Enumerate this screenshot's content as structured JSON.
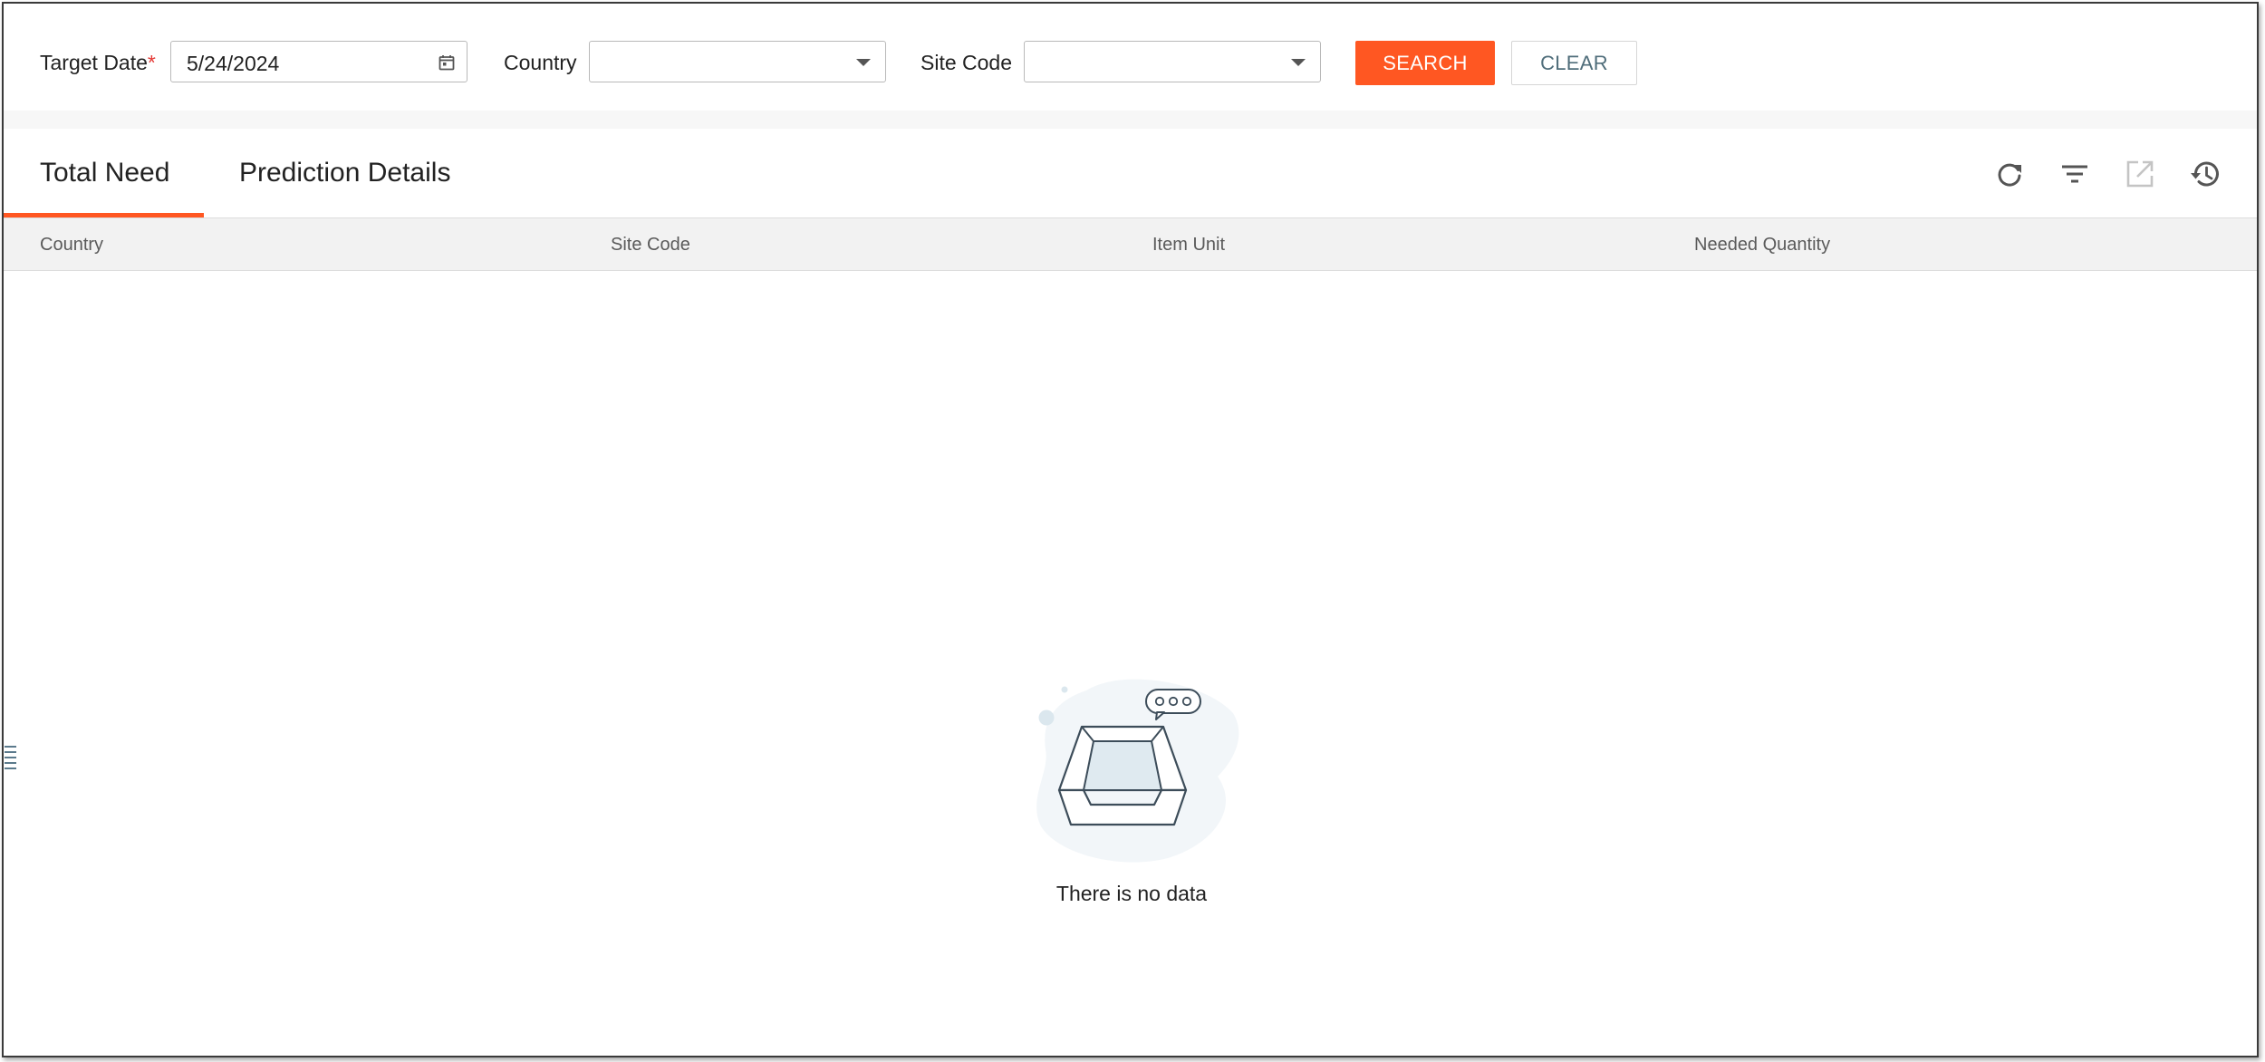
{
  "filters": {
    "target_date_label": "Target Date",
    "required_mark": "*",
    "target_date_value": "5/24/2024",
    "country_label": "Country",
    "country_value": "",
    "site_code_label": "Site Code",
    "site_code_value": "",
    "search_label": "SEARCH",
    "clear_label": "CLEAR"
  },
  "tabs": [
    {
      "label": "Total Need",
      "active": true
    },
    {
      "label": "Prediction Details",
      "active": false
    }
  ],
  "toolbar": {
    "icons": [
      "refresh-icon",
      "filter-icon",
      "export-icon",
      "history-icon"
    ]
  },
  "table": {
    "columns": [
      "Country",
      "Site Code",
      "Item Unit",
      "Needed Quantity"
    ],
    "rows": [],
    "empty_message": "There is no data"
  },
  "colors": {
    "accent": "#ff5722",
    "required": "#e53935",
    "clear_text": "#4f6d7a",
    "header_bg": "#f2f2f2"
  }
}
